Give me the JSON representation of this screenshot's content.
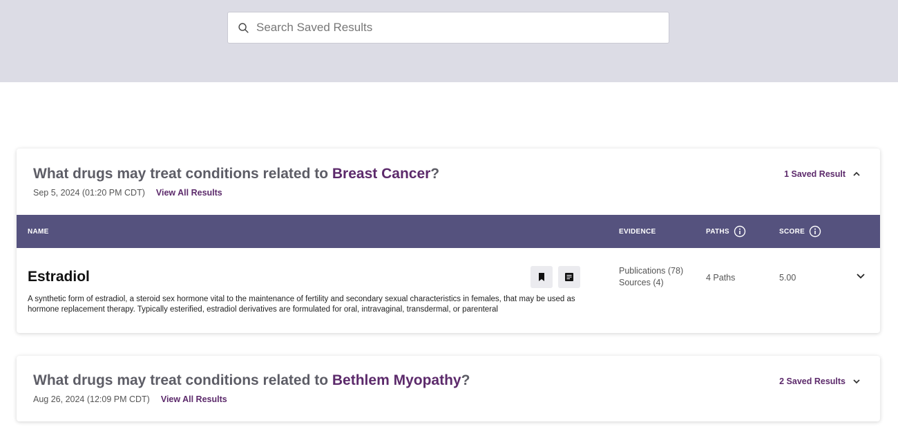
{
  "search": {
    "placeholder": "Search Saved Results",
    "value": ""
  },
  "queries": [
    {
      "prefix": "What drugs may treat conditions related to ",
      "condition": "Breast Cancer",
      "suffix": "?",
      "date": "Sep 5, 2024 (01:20 PM CDT)",
      "view_all": "View All Results",
      "saved_count": "1 Saved Result",
      "expanded": true,
      "columns": {
        "name": "NAME",
        "evidence": "EVIDENCE",
        "paths": "PATHS",
        "score": "SCORE"
      },
      "results": [
        {
          "name": "Estradiol",
          "description": "A synthetic form of estradiol, a steroid sex hormone vital to the maintenance of fertility and secondary sexual characteristics in females, that may be used as hormone replacement therapy. Typically esterified, estradiol derivatives are formulated for oral, intravaginal, transdermal, or parenteral",
          "publications": "Publications (78)",
          "sources": "Sources (4)",
          "paths": "4 Paths",
          "score": "5.00"
        }
      ]
    },
    {
      "prefix": "What drugs may treat conditions related to ",
      "condition": "Bethlem Myopathy",
      "suffix": "?",
      "date": "Aug 26, 2024 (12:09 PM CDT)",
      "view_all": "View All Results",
      "saved_count": "2 Saved Results",
      "expanded": false
    }
  ],
  "colors": {
    "accent": "#5c2a6b",
    "table_header": "#55527e",
    "top_band": "#dcdce5"
  },
  "icons": [
    "search-icon",
    "chevron-up-icon",
    "chevron-down-icon",
    "info-icon",
    "bookmark-icon",
    "notes-icon"
  ]
}
